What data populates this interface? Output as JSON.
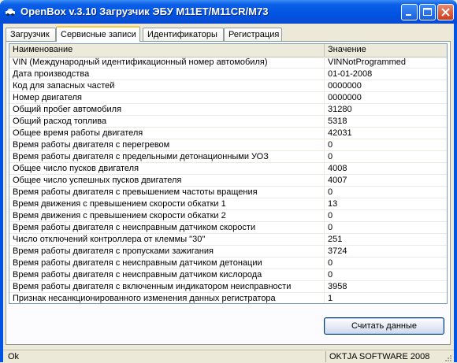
{
  "window": {
    "title": "OpenBox v.3.10 Загрузчик ЭБУ М11ET/M11CR/M73"
  },
  "tabs": [
    {
      "label": "Загрузчик",
      "active": false
    },
    {
      "label": "Сервисные записи",
      "active": true
    },
    {
      "label": "Идентификаторы",
      "active": false
    },
    {
      "label": "Регистрация",
      "active": false
    }
  ],
  "grid": {
    "columns": {
      "name": "Наименование",
      "value": "Значение"
    },
    "rows": [
      {
        "name": "VIN (Международный идентификационный номер автомобиля)",
        "value": "VINNotProgrammed"
      },
      {
        "name": "Дата производства",
        "value": "01-01-2008"
      },
      {
        "name": "Код для запасных частей",
        "value": "0000000"
      },
      {
        "name": "Номер двигателя",
        "value": "0000000"
      },
      {
        "name": "Общий пробег автомобиля",
        "value": "31280"
      },
      {
        "name": "Общий расход топлива",
        "value": "5318"
      },
      {
        "name": "Общее время работы двигателя",
        "value": "42031"
      },
      {
        "name": "Время работы двигателя с перегревом",
        "value": "0"
      },
      {
        "name": "Время работы двигателя с предельными детонационными УОЗ",
        "value": "0"
      },
      {
        "name": "Общее число пусков двигателя",
        "value": "4008"
      },
      {
        "name": "Общее число успешных пусков двигателя",
        "value": "4007"
      },
      {
        "name": "Время работы двигателя с превышением частоты вращения",
        "value": "0"
      },
      {
        "name": "Время движения с превышением скорости обкатки 1",
        "value": "13"
      },
      {
        "name": "Время движения с превышением скорости обкатки 2",
        "value": "0"
      },
      {
        "name": "Время работы двигателя с неисправным датчиком скорости",
        "value": "0"
      },
      {
        "name": "Число отключений контроллера от клеммы \"30\"",
        "value": "251"
      },
      {
        "name": "Время работы двигателя с пропусками зажигания",
        "value": "3724"
      },
      {
        "name": "Время работы двигателя с неисправным датчиком детонации",
        "value": "0"
      },
      {
        "name": "Время работы двигателя с неисправным датчиком кислорода",
        "value": "0"
      },
      {
        "name": "Время работы двигателя с включенным индикатором неисправности",
        "value": "3958"
      },
      {
        "name": "Признак несанкционированного изменения данных регистратора",
        "value": "1"
      }
    ]
  },
  "buttons": {
    "read": "Считать данные"
  },
  "statusbar": {
    "left": "Ok",
    "right": "OKTJA SOFTWARE 2008"
  },
  "icons": {
    "app": "car-icon",
    "minimize": "minimize-icon",
    "maximize": "maximize-icon",
    "close": "close-icon"
  },
  "colors": {
    "titlebar": "#0054e3",
    "active_tab_accent": "#ffc83c",
    "close_button": "#cd3d1c"
  }
}
